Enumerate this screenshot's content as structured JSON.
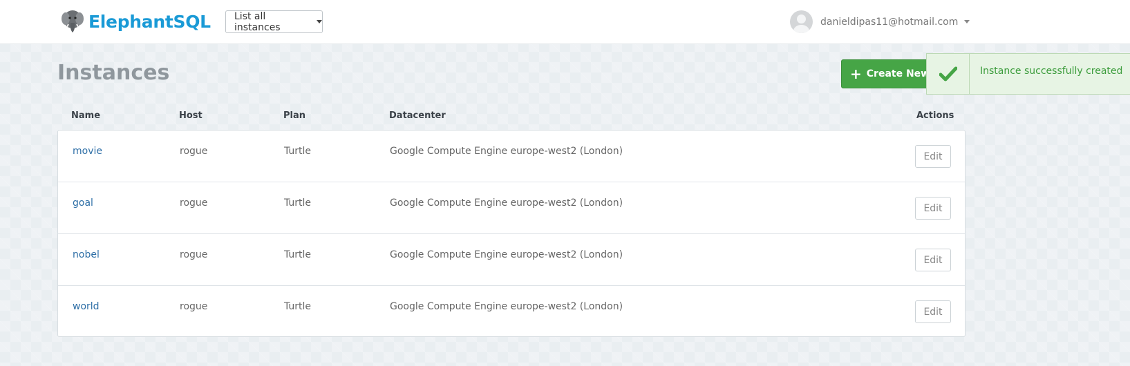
{
  "header": {
    "brand": "ElephantSQL",
    "instance_select": "List all instances",
    "user_email": "danieldipas11@hotmail.com"
  },
  "page": {
    "title": "Instances",
    "create_button": "Create New Instance"
  },
  "toast": {
    "message": "Instance successfully created",
    "color": "#46a546"
  },
  "table": {
    "headers": [
      "Name",
      "Host",
      "Plan",
      "Datacenter",
      "Actions"
    ],
    "rows": [
      {
        "name": "movie",
        "host": "rogue",
        "plan": "Turtle",
        "datacenter": "Google Compute Engine europe-west2 (London)",
        "action": "Edit"
      },
      {
        "name": "goal",
        "host": "rogue",
        "plan": "Turtle",
        "datacenter": "Google Compute Engine europe-west2 (London)",
        "action": "Edit"
      },
      {
        "name": "nobel",
        "host": "rogue",
        "plan": "Turtle",
        "datacenter": "Google Compute Engine europe-west2 (London)",
        "action": "Edit"
      },
      {
        "name": "world",
        "host": "rogue",
        "plan": "Turtle",
        "datacenter": "Google Compute Engine europe-west2 (London)",
        "action": "Edit"
      }
    ]
  }
}
